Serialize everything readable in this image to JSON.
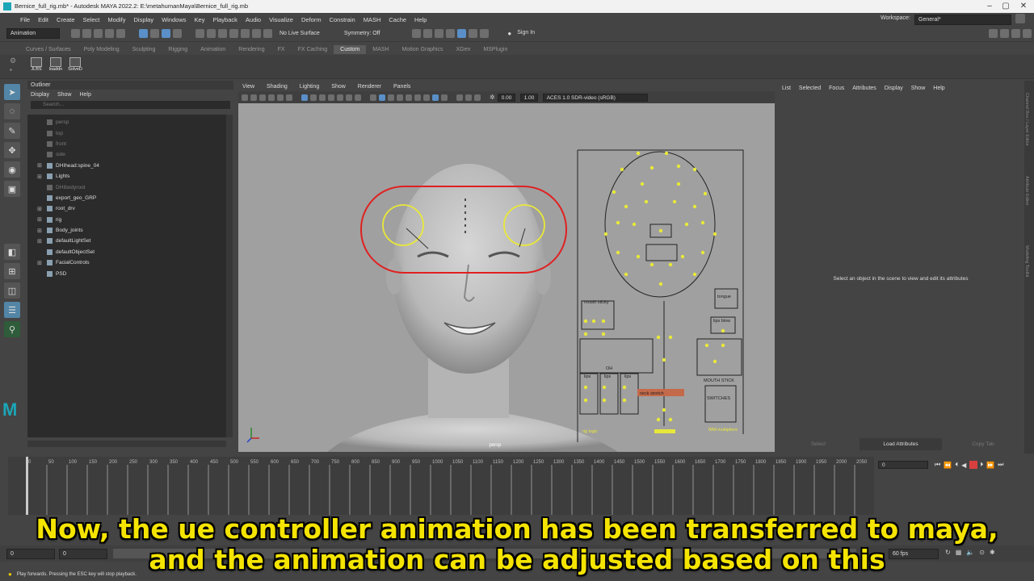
{
  "window": {
    "title": "Bernice_full_rig.mb* - Autodesk MAYA 2022.2: E:\\metahumanMaya\\Bernice_full_rig.mb"
  },
  "menubar": [
    "File",
    "Edit",
    "Create",
    "Select",
    "Modify",
    "Display",
    "Windows",
    "Key",
    "Playback",
    "Audio",
    "Visualize",
    "Deform",
    "Constrain",
    "MASH",
    "Cache",
    "Help"
  ],
  "workspace": {
    "label": "Workspace:",
    "value": "General*"
  },
  "statusline": {
    "mode": "Animation",
    "live_surface": "No Live Surface",
    "symmetry": "Symmetry: Off",
    "sign_in": "Sign In"
  },
  "shelf_tabs": [
    "Curves / Surfaces",
    "Poly Modeling",
    "Sculpting",
    "Rigging",
    "Animation",
    "Rendering",
    "FX",
    "FX Caching",
    "Custom",
    "MASH",
    "Motion Graphics",
    "XGen",
    "MSPlugin"
  ],
  "shelf_active": "Custom",
  "shelf_buttons": [
    "JLBS",
    "loaddn",
    "SolveD"
  ],
  "outliner": {
    "title": "Outliner",
    "menu": [
      "Display",
      "Show",
      "Help"
    ],
    "search_placeholder": "Search...",
    "items": [
      {
        "name": "persp",
        "expandable": false,
        "dim": true
      },
      {
        "name": "top",
        "expandable": false,
        "dim": true
      },
      {
        "name": "front",
        "expandable": false,
        "dim": true
      },
      {
        "name": "side",
        "expandable": false,
        "dim": true
      },
      {
        "name": "DHIhead:spine_04",
        "expandable": true,
        "dim": false
      },
      {
        "name": "Lights",
        "expandable": true,
        "dim": false
      },
      {
        "name": "DHIbodyroot",
        "expandable": false,
        "dim": true
      },
      {
        "name": "export_geo_GRP",
        "expandable": false,
        "dim": false
      },
      {
        "name": "root_drv",
        "expandable": true,
        "dim": false
      },
      {
        "name": "rig",
        "expandable": true,
        "dim": false
      },
      {
        "name": "Body_joints",
        "expandable": true,
        "dim": false
      },
      {
        "name": "defaultLightSet",
        "expandable": true,
        "dim": false
      },
      {
        "name": "defaultObjectSet",
        "expandable": false,
        "dim": false
      },
      {
        "name": "FacialControls",
        "expandable": true,
        "dim": false
      },
      {
        "name": "PSD",
        "expandable": false,
        "dim": false
      }
    ]
  },
  "viewport": {
    "menu": [
      "View",
      "Shading",
      "Lighting",
      "Show",
      "Renderer",
      "Panels"
    ],
    "exposure": "0.00",
    "gamma": "1.00",
    "color_space": "ACES 1.0 SDR-video (sRGB)",
    "camera_label": "persp",
    "rig_labels": {
      "mouth_sticky": "mouth sticky",
      "tongue": "tongue",
      "lips_blow": "lips blow",
      "lips_label_1": "lips",
      "lips_label_2": "lips",
      "lips_label_3": "lips",
      "ohh": "OH",
      "neck_stretch": "neck stretch",
      "mouth_stick": "MOUTH STICK",
      "switches": "SWITCHES",
      "rig_logic": "rig logic",
      "wm_multipliers": "WM multipliers"
    }
  },
  "attribute_editor": {
    "menu": [
      "List",
      "Selected",
      "Focus",
      "Attributes",
      "Display",
      "Show",
      "Help"
    ],
    "message": "Select an object in the scene to view and edit its attributes",
    "buttons": [
      "Select",
      "Load Attributes",
      "Copy Tab"
    ],
    "side_tabs": [
      "Channel Box / Layer Editor",
      "Attribute Editor",
      "Modeling Toolkit"
    ]
  },
  "timeline": {
    "ticks": [
      "0",
      "50",
      "100",
      "150",
      "200",
      "250",
      "300",
      "350",
      "400",
      "450",
      "500",
      "550",
      "600",
      "650",
      "700",
      "750",
      "800",
      "850",
      "900",
      "950",
      "1000",
      "1050",
      "1100",
      "1150",
      "1200",
      "1250",
      "1300",
      "1350",
      "1400",
      "1450",
      "1500",
      "1550",
      "1600",
      "1650",
      "1700",
      "1750",
      "1800",
      "1850",
      "1900",
      "1950",
      "2000",
      "2050"
    ],
    "current_frame": "0"
  },
  "range": {
    "start": "0",
    "start_inner": "0",
    "fps": "60 fps"
  },
  "helpline": "Play forwards. Pressing the ESC key will stop playback.",
  "subtitles": {
    "line1": "Now, the ue controller animation has been transferred to maya,",
    "line2": "and the animation can be adjusted based on this"
  },
  "colors": {
    "accent": "#5285a6",
    "subtitle": "#f5e400",
    "control_yellow": "#e8e83a",
    "control_red": "#e02020"
  }
}
